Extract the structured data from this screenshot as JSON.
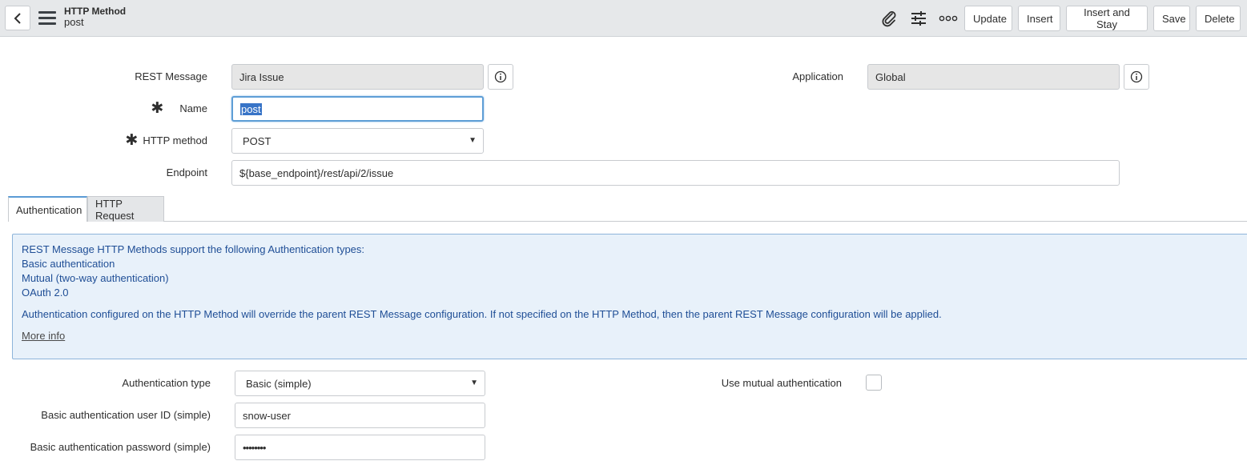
{
  "header": {
    "title": "HTTP Method",
    "subtitle": "post",
    "buttons": {
      "update": "Update",
      "insert": "Insert",
      "insert_and_stay": "Insert and Stay",
      "save": "Save",
      "delete": "Delete"
    },
    "icons": [
      "back-chevron-icon",
      "hamburger-menu-icon",
      "paperclip-icon",
      "sliders-icon",
      "more-options-icon"
    ]
  },
  "form": {
    "rest_message": {
      "label": "REST Message",
      "value": "Jira Issue"
    },
    "application": {
      "label": "Application",
      "value": "Global"
    },
    "name": {
      "label": "Name",
      "value": "post",
      "required_mark": "✱"
    },
    "http_method": {
      "label": "HTTP method",
      "value": "POST",
      "required_mark": "✱"
    },
    "endpoint": {
      "label": "Endpoint",
      "value": "${base_endpoint}/rest/api/2/issue"
    }
  },
  "tabs": [
    {
      "label": "Authentication",
      "active": true
    },
    {
      "label": "HTTP Request",
      "active": false
    }
  ],
  "info": {
    "line1": "REST Message HTTP Methods support the following Authentication types:",
    "line2": "Basic authentication",
    "line3": "Mutual (two-way authentication)",
    "line4": "OAuth 2.0",
    "line5": "Authentication configured on the HTTP Method will override the parent REST Message configuration. If not specified on the HTTP Method, then the parent REST Message configuration will be applied.",
    "more_info": "More info"
  },
  "auth": {
    "type": {
      "label": "Authentication type",
      "value": "Basic (simple)"
    },
    "mutual": {
      "label": "Use mutual authentication",
      "checked": false
    },
    "user_id": {
      "label": "Basic authentication user ID (simple)",
      "value": "snow-user"
    },
    "password": {
      "label": "Basic authentication password (simple)",
      "value": "••••••••"
    }
  },
  "colors": {
    "header_bg": "#e6e8ea",
    "info_bg": "#e8f1fa",
    "info_text": "#1f4e96",
    "focus_border": "#5e9ed6",
    "selection": "#3874c7"
  }
}
